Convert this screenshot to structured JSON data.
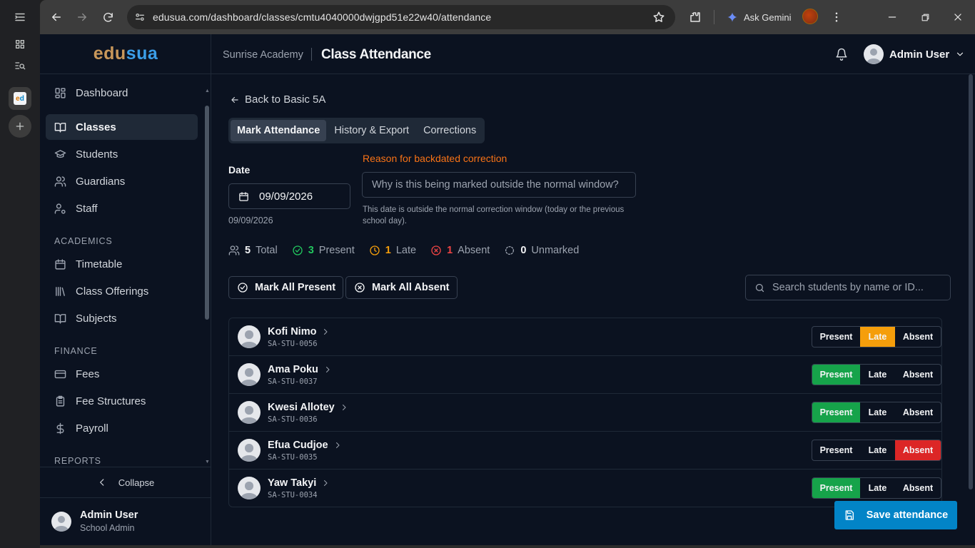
{
  "browser": {
    "url": "edusua.com/dashboard/classes/cmtu4040000dwjgpd51e22w40/attendance",
    "gemini_label": "Ask Gemini"
  },
  "app": {
    "logo_part1": "edu",
    "logo_part2": "sua"
  },
  "sidebar": {
    "items": [
      {
        "label": "Dashboard",
        "icon": "dashboard-icon"
      },
      {
        "label": "Classes",
        "icon": "book-open-icon",
        "active": true
      },
      {
        "label": "Students",
        "icon": "graduation-cap-icon"
      },
      {
        "label": "Guardians",
        "icon": "users-icon"
      },
      {
        "label": "Staff",
        "icon": "user-cog-icon"
      }
    ],
    "section_academics": "ACADEMICS",
    "academics_items": [
      {
        "label": "Timetable",
        "icon": "calendar-icon"
      },
      {
        "label": "Class Offerings",
        "icon": "library-icon"
      },
      {
        "label": "Subjects",
        "icon": "book-open-icon"
      }
    ],
    "section_finance": "FINANCE",
    "finance_items": [
      {
        "label": "Fees",
        "icon": "credit-card-icon"
      },
      {
        "label": "Fee Structures",
        "icon": "clipboard-list-icon"
      },
      {
        "label": "Payroll",
        "icon": "dollar-sign-icon"
      }
    ],
    "section_reports": "REPORTS",
    "collapse_label": "Collapse",
    "user": {
      "name": "Admin User",
      "role": "School Admin"
    }
  },
  "header": {
    "school": "Sunrise Academy",
    "title": "Class Attendance",
    "user_name": "Admin User"
  },
  "main": {
    "back_label": "Back to Basic 5A",
    "tabs": [
      "Mark Attendance",
      "History & Export",
      "Corrections"
    ],
    "date_label": "Date",
    "date_value": "09/09/2026",
    "date_sub": "09/09/2026",
    "reason_label": "Reason for backdated correction",
    "reason_placeholder": "Why is this being marked outside the normal window?",
    "reason_help": "This date is outside the normal correction window (today or the previous school day).",
    "stats": {
      "total": "5",
      "total_label": "Total",
      "present": "3",
      "present_label": "Present",
      "late": "1",
      "late_label": "Late",
      "absent": "1",
      "absent_label": "Absent",
      "unmarked": "0",
      "unmarked_label": "Unmarked"
    },
    "mark_all_present": "Mark All Present",
    "mark_all_absent": "Mark All Absent",
    "search_placeholder": "Search students by name or ID...",
    "status_labels": {
      "present": "Present",
      "late": "Late",
      "absent": "Absent"
    },
    "students": [
      {
        "name": "Kofi Nimo",
        "id": "SA-STU-0056",
        "status": "late"
      },
      {
        "name": "Ama Poku",
        "id": "SA-STU-0037",
        "status": "present"
      },
      {
        "name": "Kwesi Allotey",
        "id": "SA-STU-0036",
        "status": "present"
      },
      {
        "name": "Efua Cudjoe",
        "id": "SA-STU-0035",
        "status": "absent"
      },
      {
        "name": "Yaw Takyi",
        "id": "SA-STU-0034",
        "status": "present"
      }
    ],
    "save_label": "Save attendance"
  },
  "colors": {
    "present": "#16a34a",
    "late": "#f59e0b",
    "absent": "#dc2626",
    "accent": "#0284c7",
    "warning": "#f97316"
  }
}
